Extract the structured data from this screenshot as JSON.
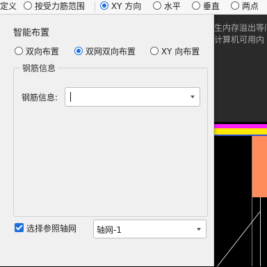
{
  "ribbon": {
    "items": [
      {
        "label": "定义"
      },
      {
        "label": "按受力筋范围"
      },
      {
        "label": "XY 方向"
      },
      {
        "label": "水平"
      },
      {
        "label": "垂直"
      },
      {
        "label": "两点"
      }
    ]
  },
  "canvas_text": {
    "line1": "生内存溢出等问",
    "line2": "计算机可用内"
  },
  "dialog": {
    "title": "智能布置",
    "modes": [
      {
        "label": "双向布置"
      },
      {
        "label": "双网双向布置"
      },
      {
        "label": "XY 向布置"
      }
    ],
    "selected_mode": "双网双向布置",
    "group_title": "钢筋信息",
    "rebar_label": "钢筋信息:",
    "rebar_value": "",
    "checkbox_label": "选择参照轴网",
    "checkbox_checked": true,
    "axis_grid_value": "轴网-1"
  },
  "colors": {
    "selected": "#1e6fd9",
    "canvas": "#000000",
    "orange": "#ff8c5a",
    "yellow": "#ffe800",
    "magenta": "#ff20ff"
  }
}
